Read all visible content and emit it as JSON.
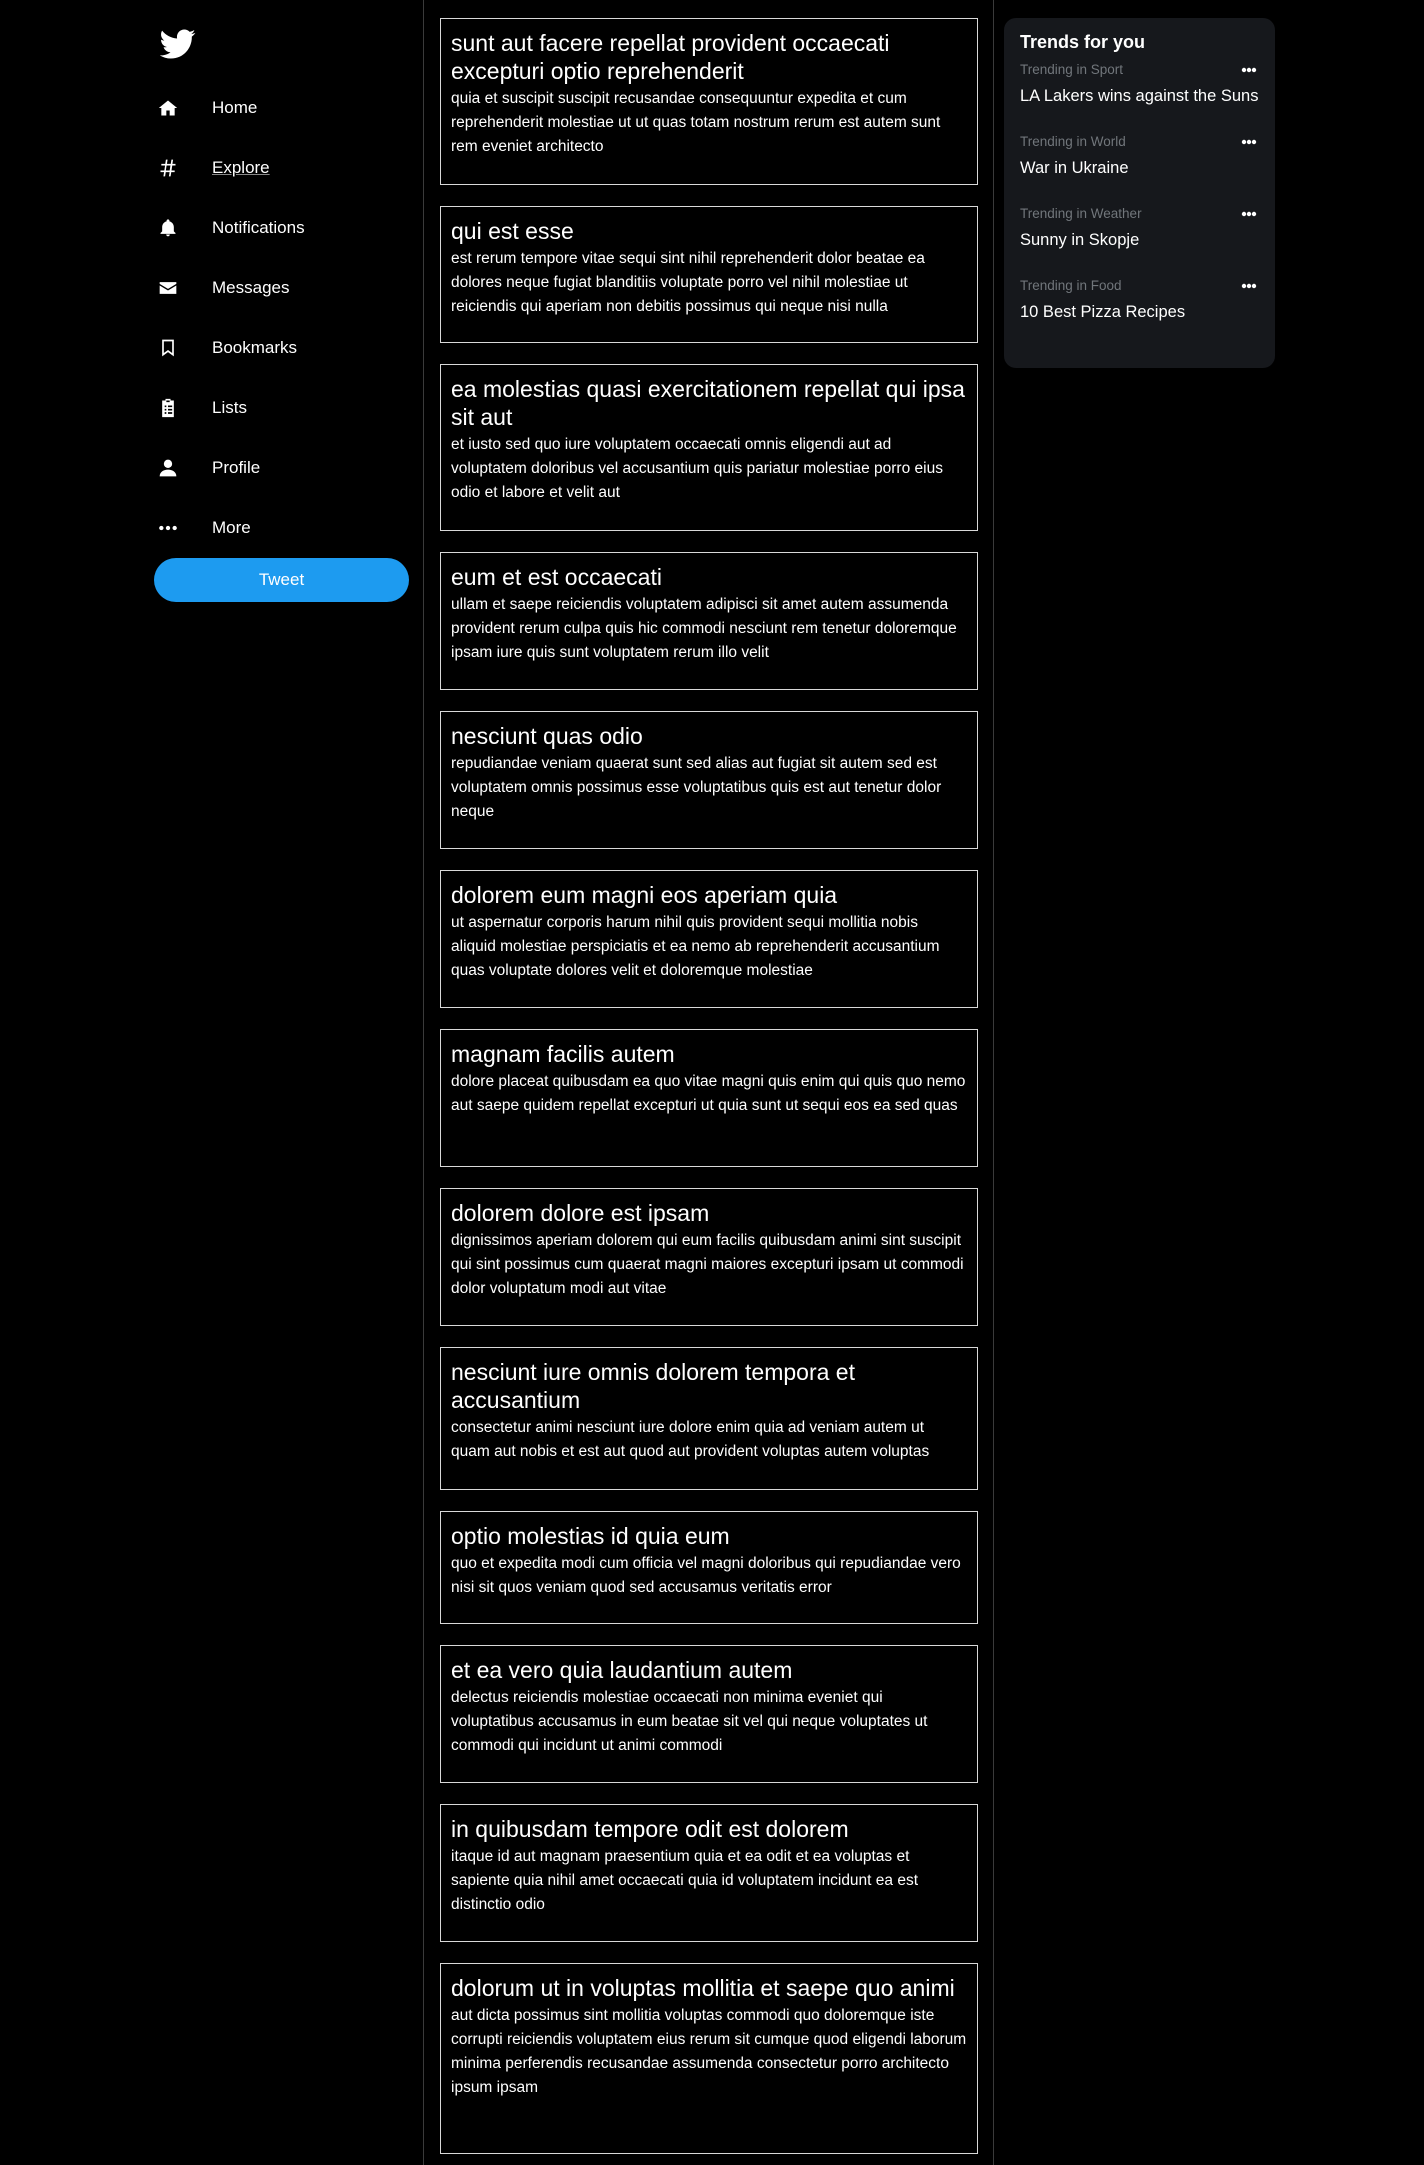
{
  "sidebar": {
    "logo_icon": "twitter-bird-icon",
    "items": [
      {
        "label": "Home",
        "icon": "home-icon"
      },
      {
        "label": "Explore",
        "icon": "hashtag-icon"
      },
      {
        "label": "Notifications",
        "icon": "bell-icon"
      },
      {
        "label": "Messages",
        "icon": "envelope-icon"
      },
      {
        "label": "Bookmarks",
        "icon": "bookmark-icon"
      },
      {
        "label": "Lists",
        "icon": "clipboard-list-icon"
      },
      {
        "label": "Profile",
        "icon": "user-icon"
      },
      {
        "label": "More",
        "icon": "ellipsis-icon"
      }
    ],
    "tweet_label": "Tweet"
  },
  "feed": {
    "posts": [
      {
        "title": "sunt aut facere repellat provident occaecati excepturi optio reprehenderit",
        "body": "quia et suscipit suscipit recusandae consequuntur expedita et cum reprehenderit molestiae ut ut quas totam nostrum rerum est autem sunt rem eveniet architecto"
      },
      {
        "title": "qui est esse",
        "body": "est rerum tempore vitae sequi sint nihil reprehenderit dolor beatae ea dolores neque fugiat blanditiis voluptate porro vel nihil molestiae ut reiciendis qui aperiam non debitis possimus qui neque nisi nulla"
      },
      {
        "title": "ea molestias quasi exercitationem repellat qui ipsa sit aut",
        "body": "et iusto sed quo iure voluptatem occaecati omnis eligendi aut ad voluptatem doloribus vel accusantium quis pariatur molestiae porro eius odio et labore et velit aut"
      },
      {
        "title": "eum et est occaecati",
        "body": "ullam et saepe reiciendis voluptatem adipisci sit amet autem assumenda provident rerum culpa quis hic commodi nesciunt rem tenetur doloremque ipsam iure quis sunt voluptatem rerum illo velit"
      },
      {
        "title": "nesciunt quas odio",
        "body": "repudiandae veniam quaerat sunt sed alias aut fugiat sit autem sed est voluptatem omnis possimus esse voluptatibus quis est aut tenetur dolor neque"
      },
      {
        "title": "dolorem eum magni eos aperiam quia",
        "body": "ut aspernatur corporis harum nihil quis provident sequi mollitia nobis aliquid molestiae perspiciatis et ea nemo ab reprehenderit accusantium quas voluptate dolores velit et doloremque molestiae"
      },
      {
        "title": "magnam facilis autem",
        "body": "dolore placeat quibusdam ea quo vitae magni quis enim qui quis quo nemo aut saepe quidem repellat excepturi ut quia sunt ut sequi eos ea sed quas"
      },
      {
        "title": "dolorem dolore est ipsam",
        "body": "dignissimos aperiam dolorem qui eum facilis quibusdam animi sint suscipit qui sint possimus cum quaerat magni maiores excepturi ipsam ut commodi dolor voluptatum modi aut vitae"
      },
      {
        "title": "nesciunt iure omnis dolorem tempora et accusantium",
        "body": "consectetur animi nesciunt iure dolore enim quia ad veniam autem ut quam aut nobis et est aut quod aut provident voluptas autem voluptas"
      },
      {
        "title": "optio molestias id quia eum",
        "body": "quo et expedita modi cum officia vel magni doloribus qui repudiandae vero nisi sit quos veniam quod sed accusamus veritatis error"
      },
      {
        "title": "et ea vero quia laudantium autem",
        "body": "delectus reiciendis molestiae occaecati non minima eveniet qui voluptatibus accusamus in eum beatae sit vel qui neque voluptates ut commodi qui incidunt ut animi commodi"
      },
      {
        "title": "in quibusdam tempore odit est dolorem",
        "body": "itaque id aut magnam praesentium quia et ea odit et ea voluptas et sapiente quia nihil amet occaecati quia id voluptatem incidunt ea est distinctio odio"
      },
      {
        "title": "dolorum ut in voluptas mollitia et saepe quo animi",
        "body": "aut dicta possimus sint mollitia voluptas commodi quo doloremque iste corrupti reiciendis voluptatem eius rerum sit cumque quod eligendi laborum minima perferendis recusandae assumenda consectetur porro architecto ipsum ipsam"
      }
    ]
  },
  "trends": {
    "title": "Trends for you",
    "more_icon": "ellipsis-icon",
    "items": [
      {
        "category": "Trending in Sport",
        "name": "LA Lakers wins against the Suns"
      },
      {
        "category": "Trending in World",
        "name": "War in Ukraine"
      },
      {
        "category": "Trending in Weather",
        "name": "Sunny in Skopje"
      },
      {
        "category": "Trending in Food",
        "name": "10 Best Pizza Recipes"
      }
    ]
  },
  "colors": {
    "background": "#000000",
    "accent": "#1d9bf0",
    "panel": "#16181c",
    "muted_text": "#71767b",
    "post_border": "#d9d9d9"
  }
}
